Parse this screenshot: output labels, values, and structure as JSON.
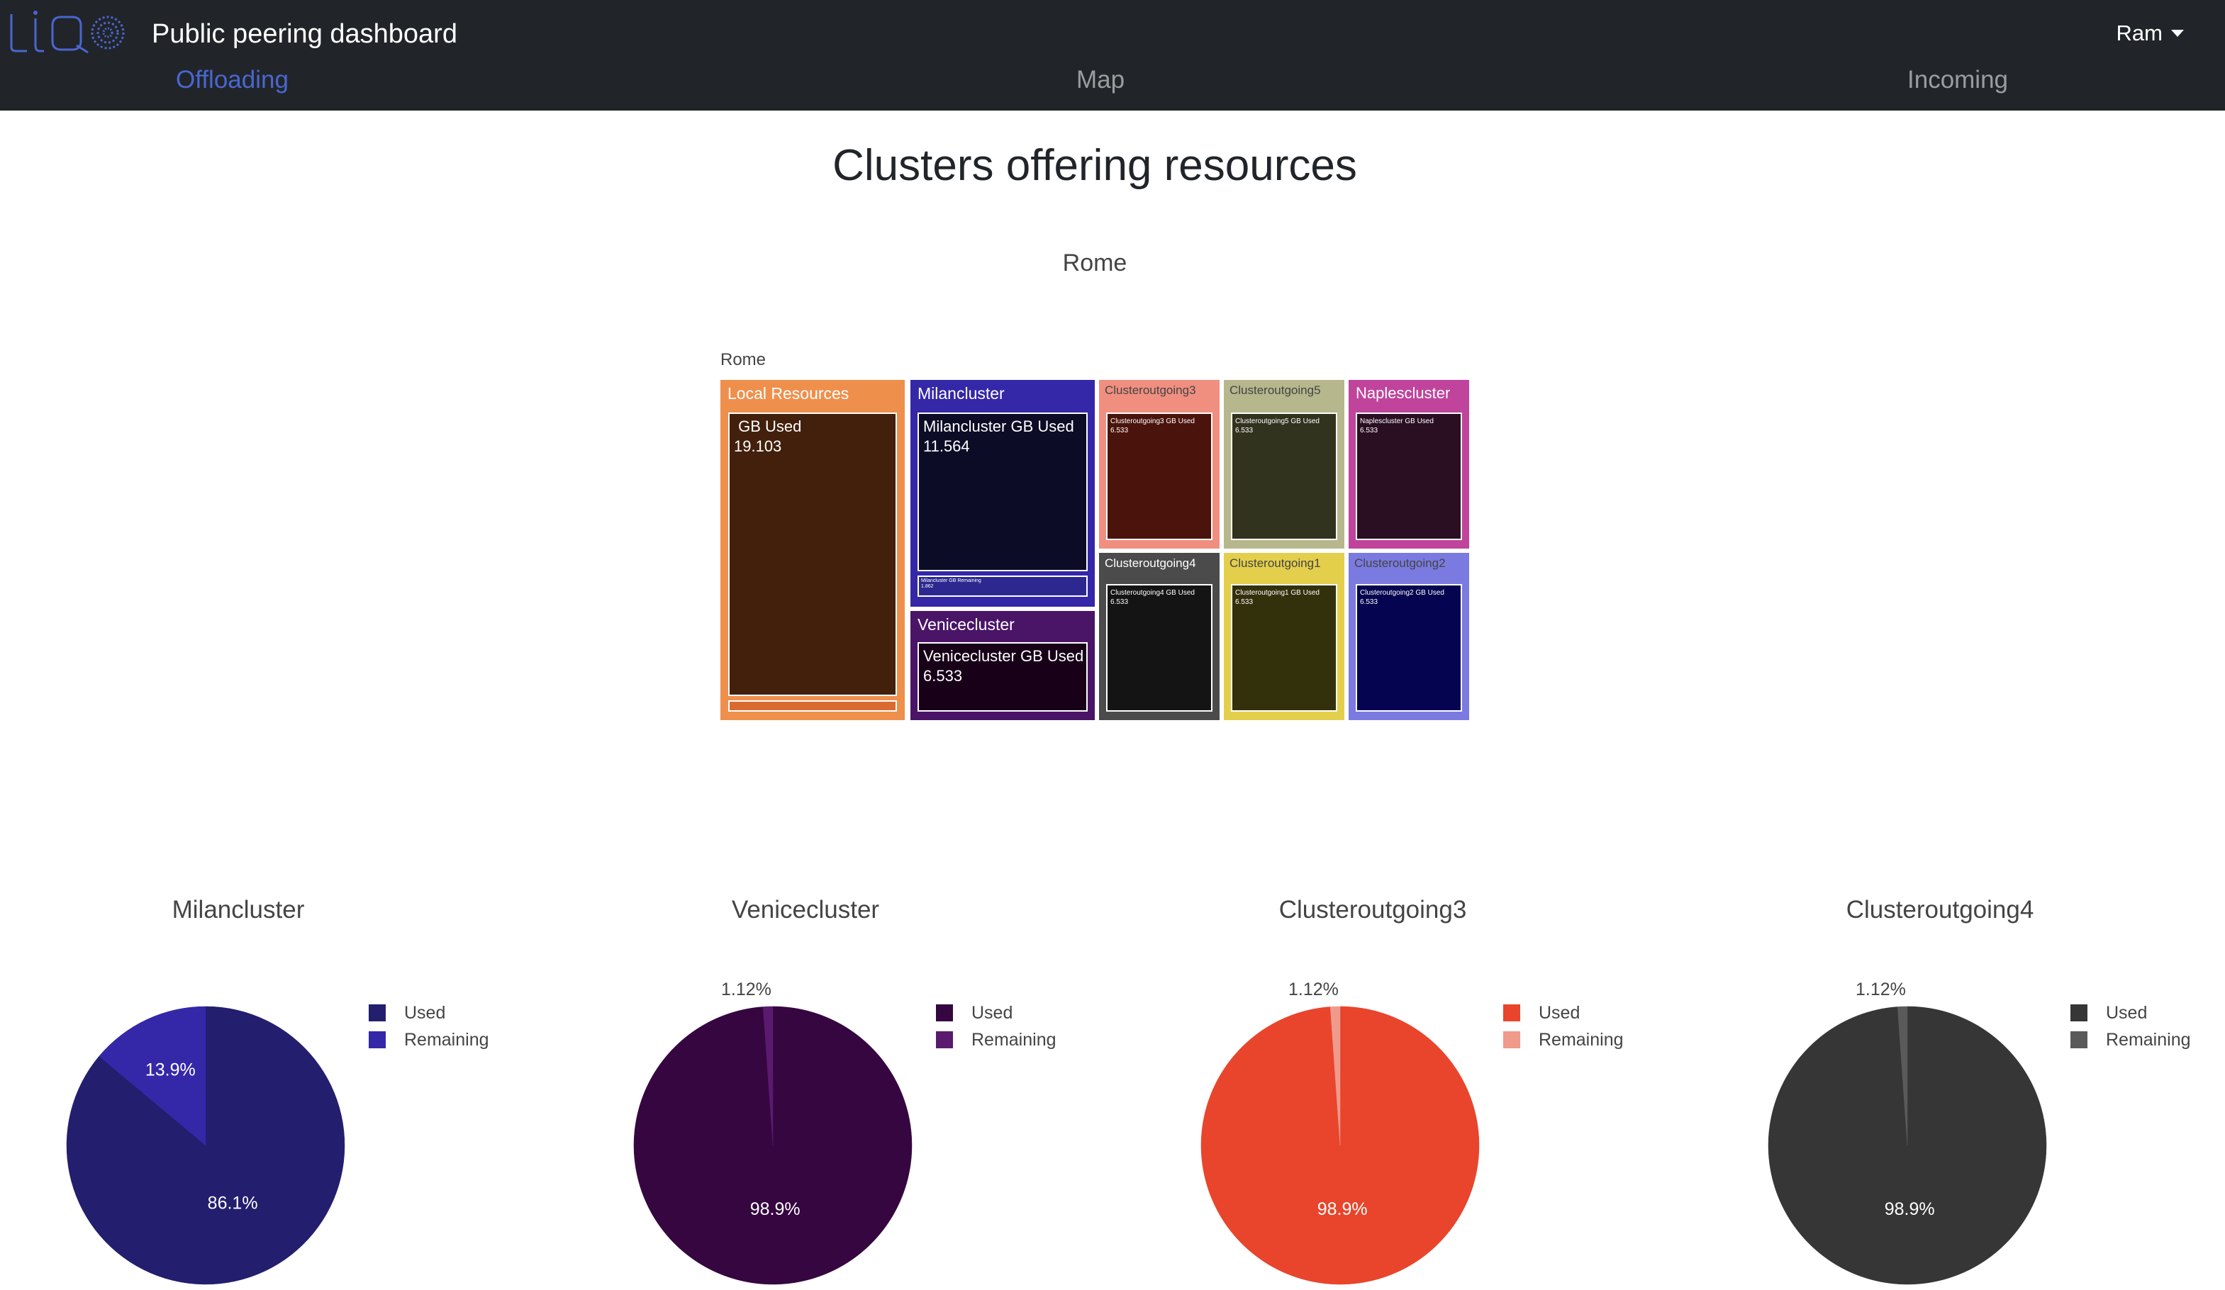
{
  "header": {
    "app_title": "Public peering dashboard",
    "user_name": "Ram",
    "tabs": [
      {
        "label": "Offloading",
        "active": true
      },
      {
        "label": "Map",
        "active": false
      },
      {
        "label": "Incoming",
        "active": false
      }
    ],
    "brand_color": "#4a66d0"
  },
  "main": {
    "title": "Clusters offering resources"
  },
  "chart_data": [
    {
      "type": "treemap",
      "title": "Rome",
      "root_label": "Rome",
      "nodes": [
        {
          "name": "Local Resources",
          "color": "#ef8f4c",
          "children": [
            {
              "label": " GB Used",
              "value": 19.103,
              "value_text": "19.103",
              "color": "#42200c"
            },
            {
              "label": "",
              "value": null,
              "color": "#d96a30"
            }
          ]
        },
        {
          "name": "Milancluster",
          "color": "#3427a8",
          "children": [
            {
              "label": "Milancluster GB Used",
              "value": 11.564,
              "value_text": "11.564",
              "color": "#0c0c26"
            },
            {
              "label": "Milancluster GB Remaining",
              "value": 1.862,
              "value_text": "1.862",
              "color": "#2c2890"
            }
          ]
        },
        {
          "name": "Venicecluster",
          "color": "#4a1467",
          "children": [
            {
              "label": "Venicecluster GB Used",
              "value": 6.533,
              "value_text": "6.533",
              "color": "#170018"
            }
          ]
        },
        {
          "name": "Clusteroutgoing3",
          "color": "#f08f80",
          "children": [
            {
              "label": "Clusteroutgoing3 GB Used",
              "value": 6.533,
              "value_text": "6.533",
              "color": "#4a140c"
            }
          ]
        },
        {
          "name": "Clusteroutgoing5",
          "color": "#b6b78c",
          "children": [
            {
              "label": "Clusteroutgoing5 GB Used",
              "value": 6.533,
              "value_text": "6.533",
              "color": "#32331f"
            }
          ]
        },
        {
          "name": "Naplescluster",
          "color": "#c0449c",
          "children": [
            {
              "label": "Naplescluster GB Used",
              "value": 6.533,
              "value_text": "6.533",
              "color": "#2a0f22"
            }
          ]
        },
        {
          "name": "Clusteroutgoing4",
          "color": "#4b4b4b",
          "children": [
            {
              "label": "Clusteroutgoing4 GB Used",
              "value": 6.533,
              "value_text": "6.533",
              "color": "#141414"
            }
          ]
        },
        {
          "name": "Clusteroutgoing1",
          "color": "#e4cf4c",
          "children": [
            {
              "label": "Clusteroutgoing1 GB Used",
              "value": 6.533,
              "value_text": "6.533",
              "color": "#33300c"
            }
          ]
        },
        {
          "name": "Clusteroutgoing2",
          "color": "#7a7ae0",
          "children": [
            {
              "label": "Clusteroutgoing2 GB Used",
              "value": 6.533,
              "value_text": "6.533",
              "color": "#040450"
            }
          ]
        }
      ]
    },
    {
      "type": "pie",
      "title": "Milancluster",
      "slices": [
        {
          "label": "Used",
          "percent": 86.1,
          "text": "86.1%",
          "color": "#231e6e"
        },
        {
          "label": "Remaining",
          "percent": 13.9,
          "text": "13.9%",
          "color": "#3427a8"
        }
      ]
    },
    {
      "type": "pie",
      "title": "Venicecluster",
      "slices": [
        {
          "label": "Used",
          "percent": 98.88,
          "text": "98.9%",
          "color": "#360640"
        },
        {
          "label": "Remaining",
          "percent": 1.12,
          "text": "1.12%",
          "color": "#5a1a6e"
        }
      ]
    },
    {
      "type": "pie",
      "title": "Clusteroutgoing3",
      "slices": [
        {
          "label": "Used",
          "percent": 98.88,
          "text": "98.9%",
          "color": "#e8452c"
        },
        {
          "label": "Remaining",
          "percent": 1.12,
          "text": "1.12%",
          "color": "#f09a8c"
        }
      ]
    },
    {
      "type": "pie",
      "title": "Clusteroutgoing4",
      "slices": [
        {
          "label": "Used",
          "percent": 98.88,
          "text": "98.9%",
          "color": "#363636"
        },
        {
          "label": "Remaining",
          "percent": 1.12,
          "text": "1.12%",
          "color": "#5a5a5a"
        }
      ]
    }
  ]
}
